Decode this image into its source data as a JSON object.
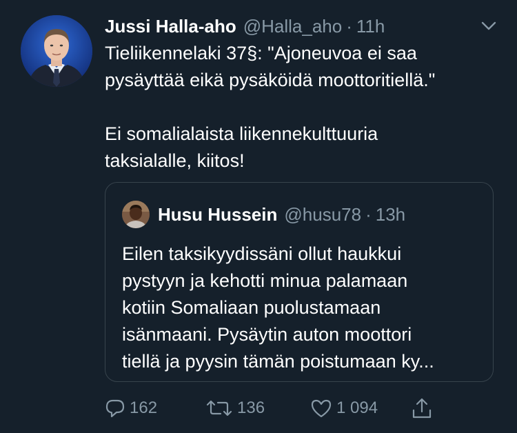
{
  "tweet": {
    "author_name": "Jussi Halla-aho",
    "author_handle": "@Halla_aho",
    "separator": "·",
    "time": "11h",
    "text_lines": [
      "Tieliikennelaki 37§: \"Ajoneuvoa ei saa",
      "pysäyttää eikä pysäköidä moottoritiellä.\"",
      "Ei somalialaista liikennekulttuuria",
      "taksialalle, kiitos!"
    ]
  },
  "quoted_tweet": {
    "author_name": "Husu Hussein",
    "author_handle": "@husu78",
    "separator": "·",
    "time": "13h",
    "text_lines": [
      "Eilen taksikyydissäni ollut haukkui",
      "pystyyn ja kehotti minua palamaan",
      "kotiin Somaliaan puolustamaan",
      "isänmaani. Pysäytin auton moottori",
      "tiellä ja pyysin tämän poistumaan ky..."
    ]
  },
  "actions": {
    "reply_count": "162",
    "retweet_count": "136",
    "like_count": "1 094"
  },
  "icons": {
    "reply": "speech-bubble-icon",
    "retweet": "retweet-arrows-icon",
    "like": "heart-icon",
    "share": "share-upload-icon",
    "menu": "chevron-down-icon"
  },
  "colors": {
    "background": "#15202b",
    "secondary_text": "#8899a6",
    "border": "#38444d"
  }
}
